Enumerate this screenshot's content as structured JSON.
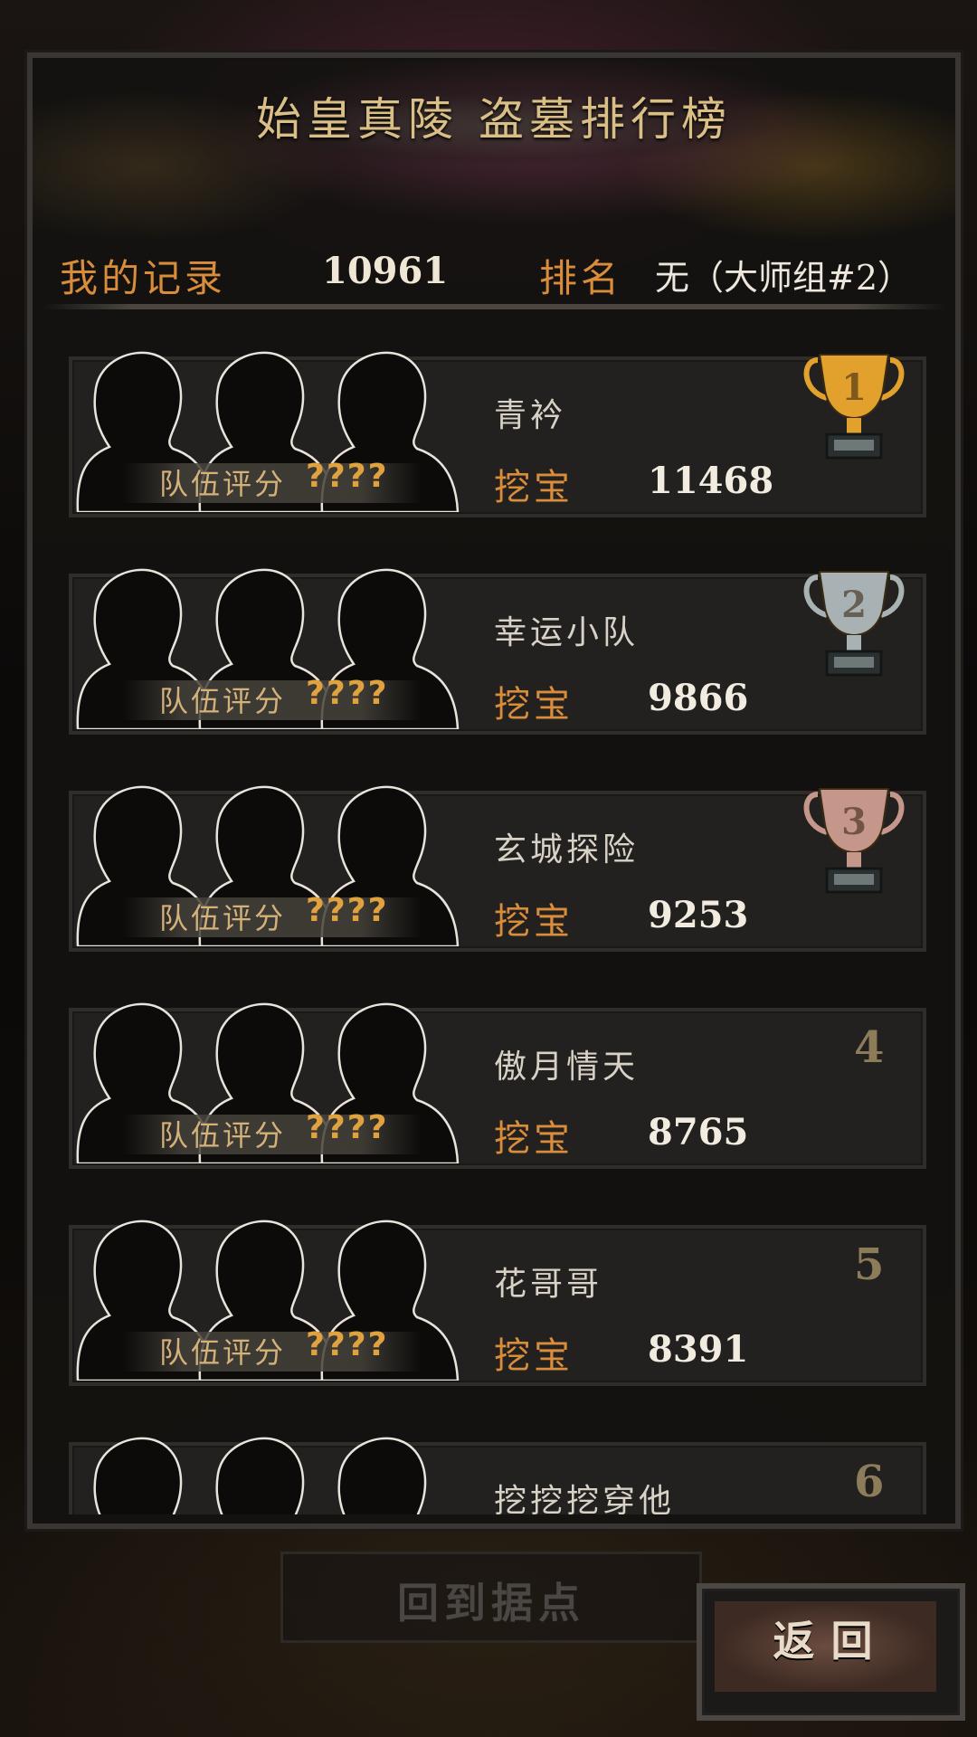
{
  "header": {
    "title": "始皇真陵 盗墓排行榜"
  },
  "my_record": {
    "label": "我的记录",
    "value": "10961",
    "rank_label": "排名",
    "rank_value": "无（大师组#2）"
  },
  "leaderboard": {
    "score_label": "队伍评分",
    "dig_label": "挖宝",
    "entries": [
      {
        "rank": "1",
        "team_name": "青衿",
        "team_score": "????",
        "dig_score": "11468",
        "trophy": "gold-trophy-icon",
        "trophy_color": "#e2a12c"
      },
      {
        "rank": "2",
        "team_name": "幸运小队",
        "team_score": "????",
        "dig_score": "9866",
        "trophy": "silver-trophy-icon",
        "trophy_color": "#a8b1b3"
      },
      {
        "rank": "3",
        "team_name": "玄城探险",
        "team_score": "????",
        "dig_score": "9253",
        "trophy": "bronze-trophy-icon",
        "trophy_color": "#c5978a"
      },
      {
        "rank": "4",
        "team_name": "傲月情天",
        "team_score": "????",
        "dig_score": "8765"
      },
      {
        "rank": "5",
        "team_name": "花哥哥",
        "team_score": "????",
        "dig_score": "8391"
      },
      {
        "rank": "6",
        "team_name": "挖挖挖穿他",
        "team_score": "",
        "dig_score": ""
      }
    ]
  },
  "buttons": {
    "back_home": "回到据点",
    "return": "返回"
  }
}
